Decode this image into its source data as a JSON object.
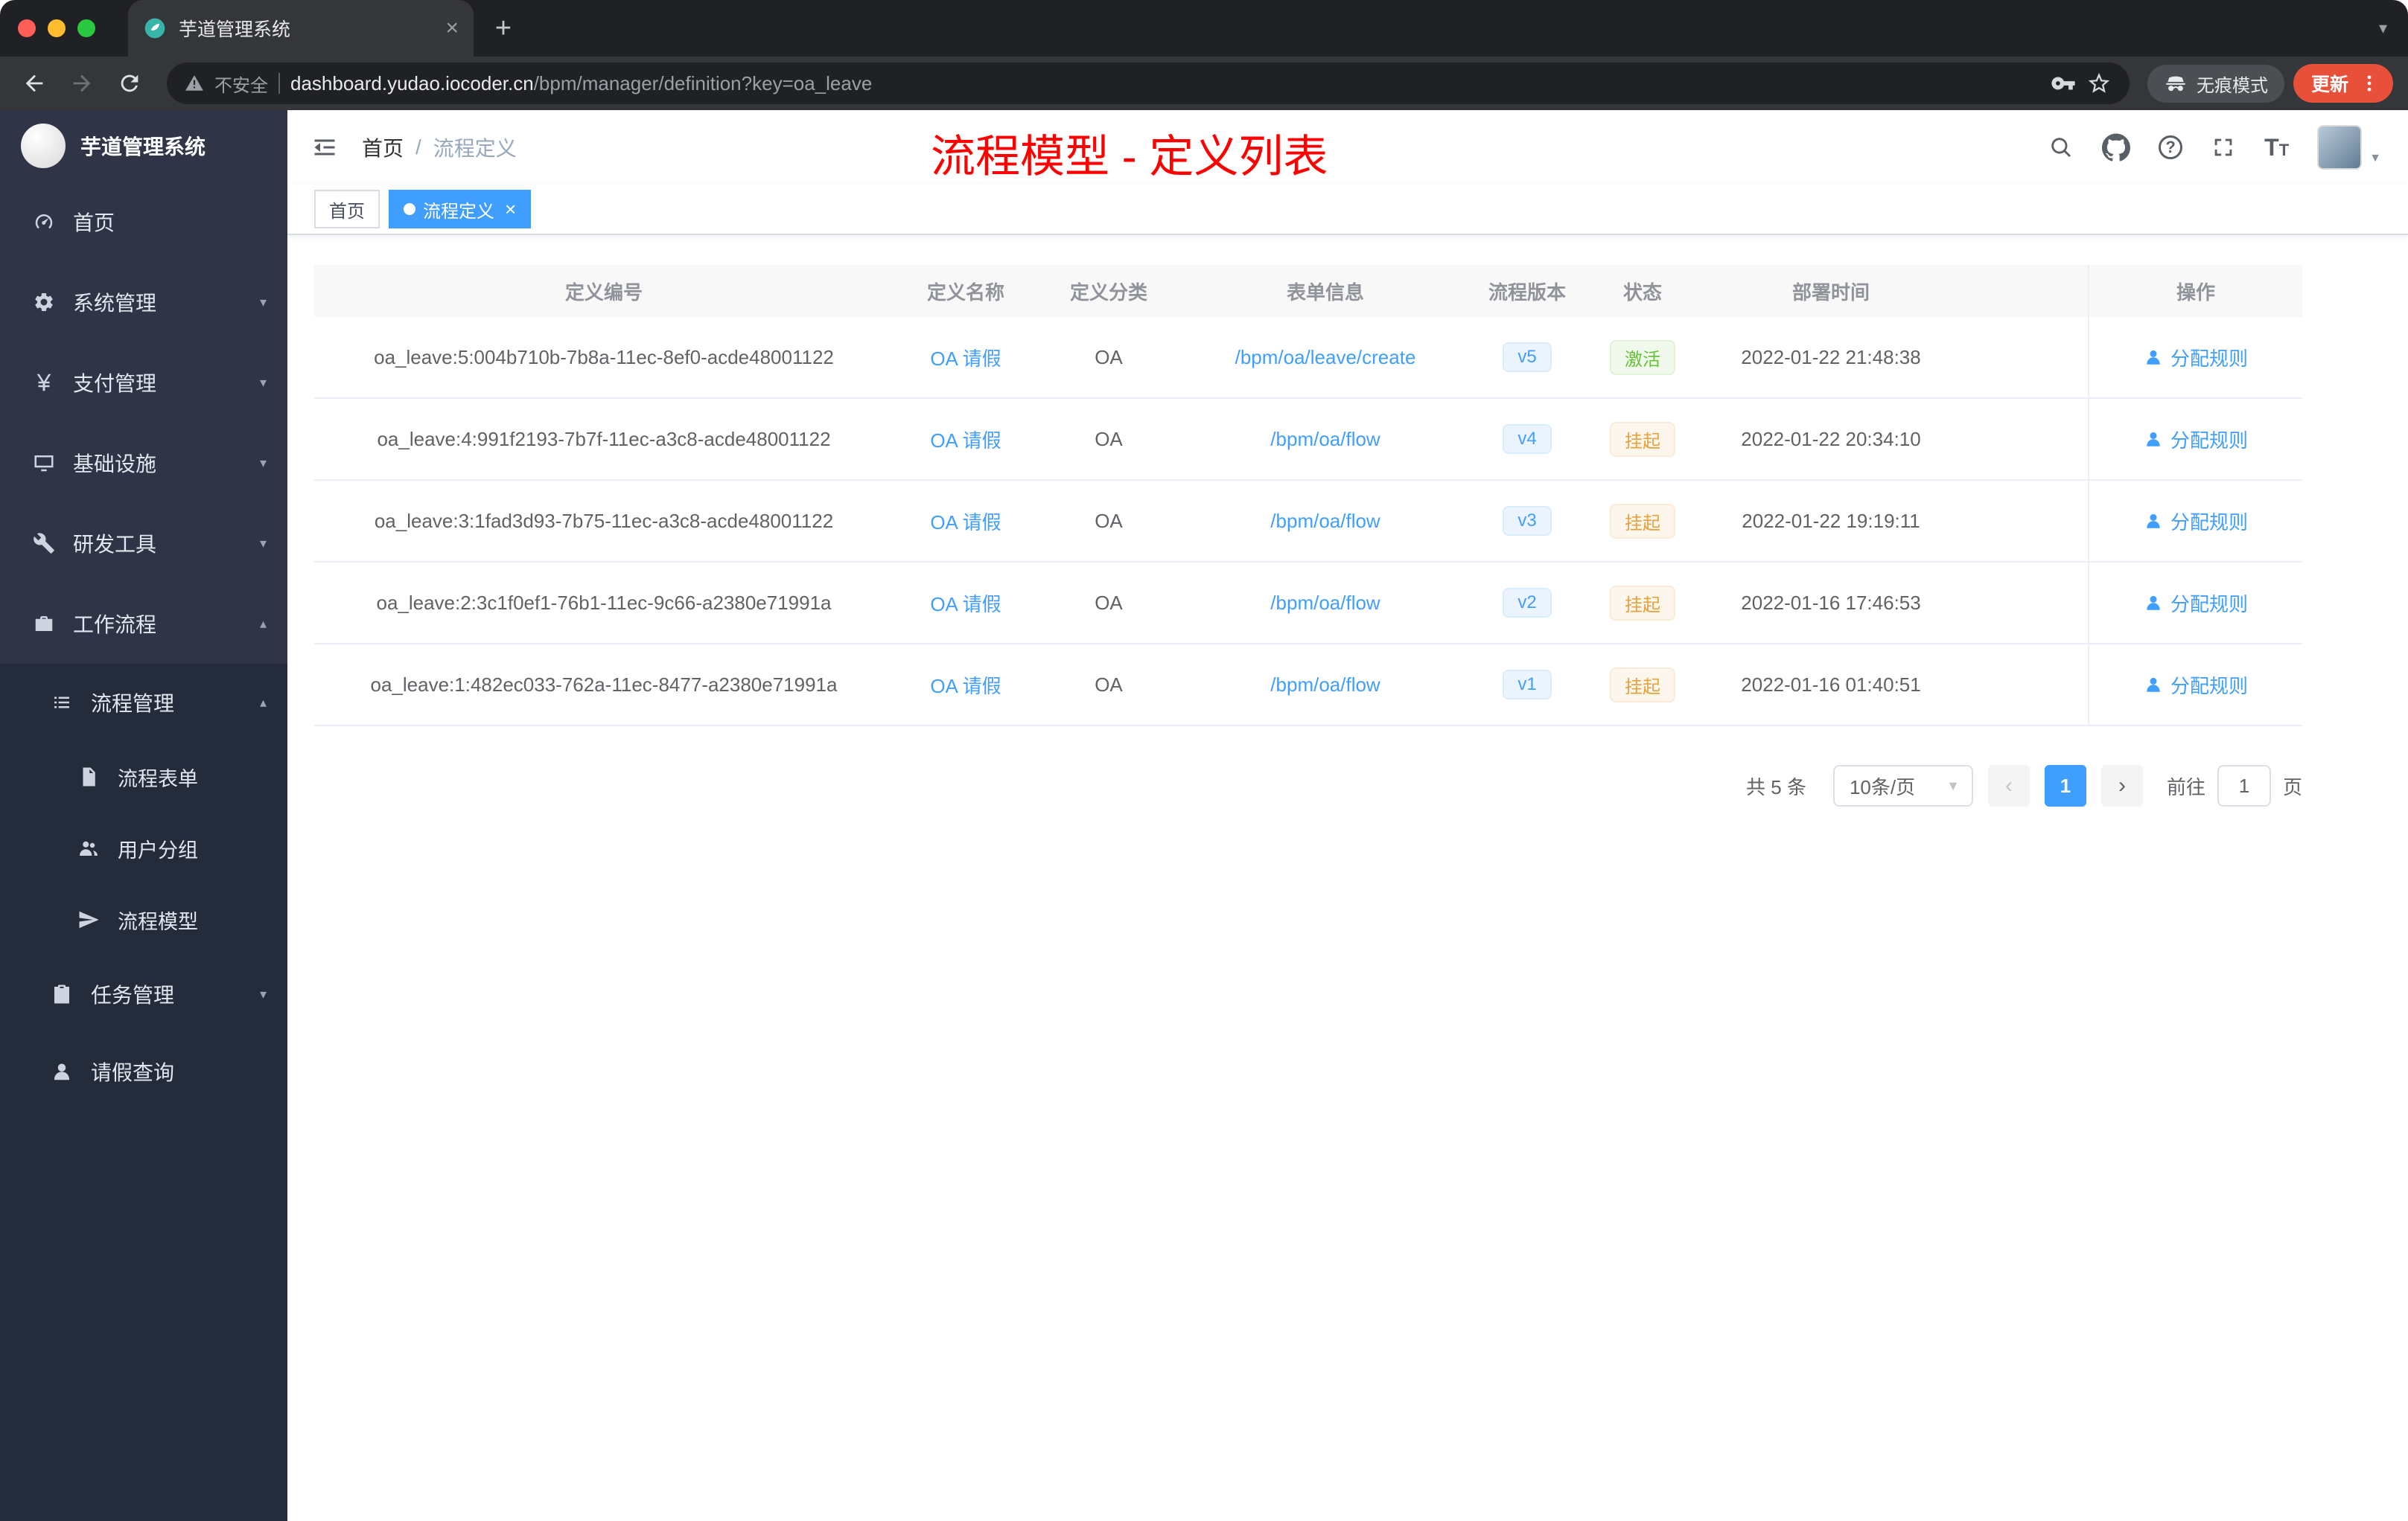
{
  "colors": {
    "accent_blue": "#409eff",
    "status_active_green": "#67c23a",
    "status_suspended_orange": "#e6a23c",
    "annotation_red": "#ff0000",
    "sidebar_bg": "#2f3447",
    "tab_active_bg": "#409eff"
  },
  "browser": {
    "tab_title": "芋道管理系统",
    "security_label": "不安全",
    "url_domain": "dashboard.yudao.iocoder.cn",
    "url_path": "/bpm/manager/definition?key=oa_leave",
    "incognito_label": "无痕模式",
    "update_label": "更新",
    "icons": [
      "back-icon",
      "forward-icon",
      "reload-icon",
      "warning-icon",
      "key-icon",
      "star-icon",
      "incognito-icon",
      "kebab-menu-icon",
      "new-tab-icon",
      "close-icon",
      "tab-search-icon"
    ]
  },
  "sidebar": {
    "logo_title": "芋道管理系统",
    "items": [
      {
        "label": "首页",
        "icon": "dashboard-icon"
      },
      {
        "label": "系统管理",
        "icon": "gear-icon"
      },
      {
        "label": "支付管理",
        "icon": "yen-icon"
      },
      {
        "label": "基础设施",
        "icon": "monitor-icon"
      },
      {
        "label": "研发工具",
        "icon": "wrench-icon"
      },
      {
        "label": "工作流程",
        "icon": "briefcase-icon"
      }
    ],
    "workflow_children": [
      {
        "label": "流程管理",
        "icon": "list-icon"
      },
      {
        "label": "流程表单",
        "icon": "document-icon"
      },
      {
        "label": "用户分组",
        "icon": "user-group-icon"
      },
      {
        "label": "流程模型",
        "icon": "paper-plane-icon"
      },
      {
        "label": "任务管理",
        "icon": "clipboard-icon"
      },
      {
        "label": "请假查询",
        "icon": "person-icon"
      }
    ]
  },
  "header": {
    "breadcrumb_home": "首页",
    "breadcrumb_sep": "/",
    "breadcrumb_current": "流程定义",
    "annotation": "流程模型 - 定义列表",
    "icons": [
      "collapse-menu-icon",
      "search-icon",
      "github-icon",
      "help-icon",
      "fullscreen-icon",
      "font-size-icon",
      "avatar",
      "caret-down-icon"
    ]
  },
  "tags": [
    {
      "label": "首页",
      "active": false
    },
    {
      "label": "流程定义",
      "active": true
    }
  ],
  "table": {
    "columns": [
      "定义编号",
      "定义名称",
      "定义分类",
      "表单信息",
      "流程版本",
      "状态",
      "部署时间",
      "操作"
    ],
    "rows": [
      {
        "id": "oa_leave:5:004b710b-7b8a-11ec-8ef0-acde48001122",
        "name": "OA 请假",
        "category": "OA",
        "form": "/bpm/oa/leave/create",
        "version": "v5",
        "status": "激活",
        "time": "2022-01-22 21:48:38",
        "action": "分配规则"
      },
      {
        "id": "oa_leave:4:991f2193-7b7f-11ec-a3c8-acde48001122",
        "name": "OA 请假",
        "category": "OA",
        "form": "/bpm/oa/flow",
        "version": "v4",
        "status": "挂起",
        "time": "2022-01-22 20:34:10",
        "action": "分配规则"
      },
      {
        "id": "oa_leave:3:1fad3d93-7b75-11ec-a3c8-acde48001122",
        "name": "OA 请假",
        "category": "OA",
        "form": "/bpm/oa/flow",
        "version": "v3",
        "status": "挂起",
        "time": "2022-01-22 19:19:11",
        "action": "分配规则"
      },
      {
        "id": "oa_leave:2:3c1f0ef1-76b1-11ec-9c66-a2380e71991a",
        "name": "OA 请假",
        "category": "OA",
        "form": "/bpm/oa/flow",
        "version": "v2",
        "status": "挂起",
        "time": "2022-01-16 17:46:53",
        "action": "分配规则"
      },
      {
        "id": "oa_leave:1:482ec033-762a-11ec-8477-a2380e71991a",
        "name": "OA 请假",
        "category": "OA",
        "form": "/bpm/oa/flow",
        "version": "v1",
        "status": "挂起",
        "time": "2022-01-16 01:40:51",
        "action": "分配规则"
      }
    ]
  },
  "pagination": {
    "total": "共 5 条",
    "page_size": "10条/页",
    "current_page": "1",
    "goto_prefix": "前往",
    "goto_value": "1",
    "goto_suffix": "页"
  }
}
